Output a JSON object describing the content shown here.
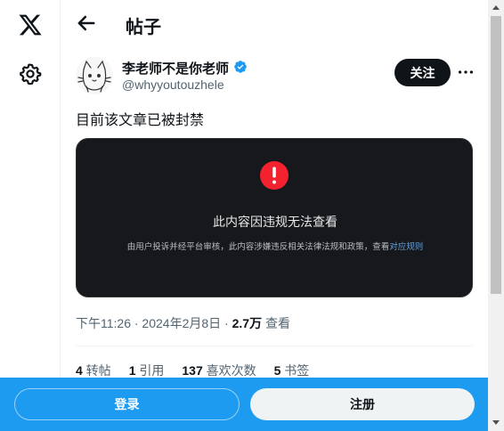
{
  "nav": {
    "logo_icon": "x-logo-icon",
    "settings_icon": "gear-icon"
  },
  "header": {
    "back_icon": "arrow-left-icon",
    "title": "帖子"
  },
  "author": {
    "name": "李老师不是你老师",
    "handle": "@whyyoutouzhele",
    "verified_icon": "verified-badge-icon",
    "follow_label": "关注",
    "more_icon": "more-horizontal-icon"
  },
  "post": {
    "text": "目前该文章已被封禁",
    "blocked": {
      "icon": "alert-circle-icon",
      "title": "此内容因违规无法查看",
      "description": "由用户投诉并经平台审核，此内容涉嫌违反相关法律法规和政策，查看",
      "link": "对应规则"
    },
    "meta": {
      "time": "下午11:26 · 2024年2月8日 · ",
      "views": "2.7万",
      "views_label": " 查看"
    },
    "stats": [
      {
        "count": "4",
        "label": " 转帖"
      },
      {
        "count": "1",
        "label": " 引用"
      },
      {
        "count": "137",
        "label": " 喜欢次数"
      },
      {
        "count": "5",
        "label": " 书签"
      }
    ]
  },
  "bottom_bar": {
    "login_label": "登录",
    "signup_label": "注册"
  },
  "colors": {
    "accent": "#1d9bf0",
    "card_bg": "#16181c",
    "alert": "#f4212e",
    "text": "#0f1419",
    "muted": "#536471"
  }
}
